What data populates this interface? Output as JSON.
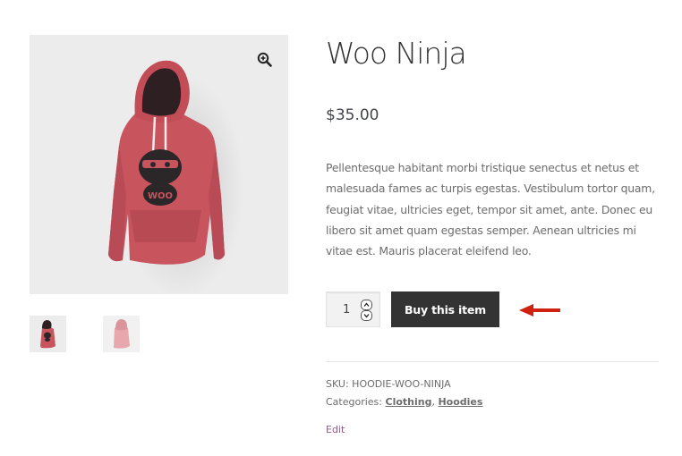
{
  "product": {
    "title": "Woo Ninja",
    "price": "$35.00",
    "description": "Pellentesque habitant morbi tristique senectus et netus et malesuada fames ac turpis egestas. Vestibulum tortor quam, feugiat vitae, ultricies eget, tempor sit amet, ante. Donec eu libero sit amet quam egestas semper. Aenean ultricies mi vitae est. Mauris placerat eleifend leo.",
    "quantity": "1",
    "buy_label": "Buy this item"
  },
  "meta": {
    "sku_label": "SKU:",
    "sku_value": "HOODIE-WOO-NINJA",
    "categories_label": "Categories:",
    "categories": [
      "Clothing",
      "Hoodies"
    ],
    "separator": ","
  },
  "edit_label": "Edit",
  "gallery": {
    "main_icon": "zoom-in-icon",
    "thumbnails": [
      "hoodie-front-thumbnail",
      "hoodie-back-thumbnail"
    ]
  },
  "colors": {
    "hoodie": "#c8545e",
    "button": "#333333",
    "arrow": "#d0200f",
    "link": "#96588a"
  }
}
